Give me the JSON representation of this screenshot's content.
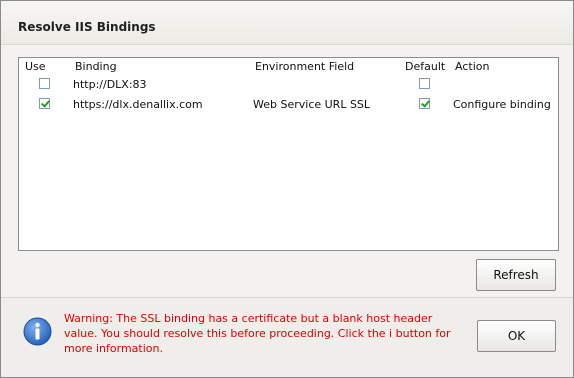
{
  "dialog": {
    "title": "Resolve IIS Bindings"
  },
  "list": {
    "headers": {
      "use": "Use",
      "binding": "Binding",
      "environment_field": "Environment Field",
      "default": "Default",
      "action": "Action"
    },
    "rows": [
      {
        "use": false,
        "binding": "http://DLX:83",
        "environment_field": "",
        "default": false,
        "action": ""
      },
      {
        "use": true,
        "binding": "https://dlx.denallix.com",
        "environment_field": "Web Service URL SSL",
        "default": true,
        "action": "Configure binding"
      }
    ]
  },
  "buttons": {
    "refresh_label": "Refresh",
    "ok_label": "OK"
  },
  "footer": {
    "warning": "Warning: The SSL binding has a certificate but a blank host header value. You should resolve this before proceeding. Click the i button for more information.",
    "info_icon": "info-icon"
  },
  "colors": {
    "warning_text": "#e00000",
    "info_icon": "#2f6fc7",
    "checkmark": "#21a121"
  }
}
